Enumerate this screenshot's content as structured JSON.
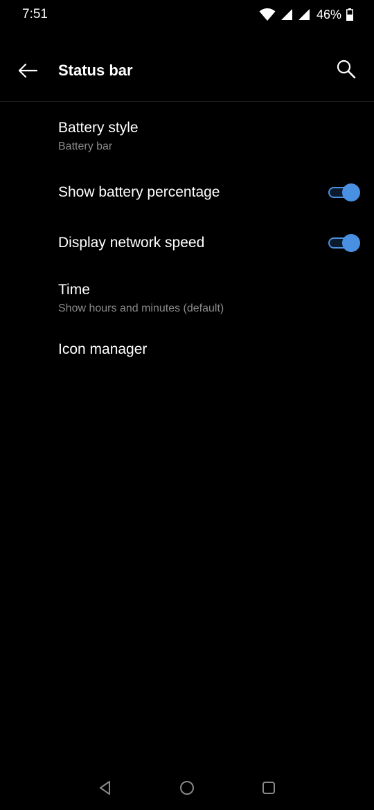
{
  "status_bar": {
    "time": "7:51",
    "battery_percent": "46%",
    "icons": [
      "wifi-icon",
      "signal-icon",
      "signal-icon",
      "battery-icon"
    ]
  },
  "app_bar": {
    "title": "Status bar",
    "back_icon": "arrow-left-icon",
    "search_icon": "search-icon"
  },
  "settings": {
    "battery_style": {
      "title": "Battery style",
      "subtitle": "Battery bar"
    },
    "show_battery_percentage": {
      "title": "Show battery percentage",
      "enabled": true
    },
    "display_network_speed": {
      "title": "Display network speed",
      "enabled": true
    },
    "time": {
      "title": "Time",
      "subtitle": "Show hours and minutes (default)"
    },
    "icon_manager": {
      "title": "Icon manager"
    }
  },
  "nav_bar": {
    "icons": [
      "back-triangle-icon",
      "home-circle-icon",
      "recents-square-icon"
    ]
  },
  "colors": {
    "background": "#000000",
    "accent": "#4a90e2",
    "text_primary": "#ffffff",
    "text_secondary": "#8a8a8a"
  }
}
